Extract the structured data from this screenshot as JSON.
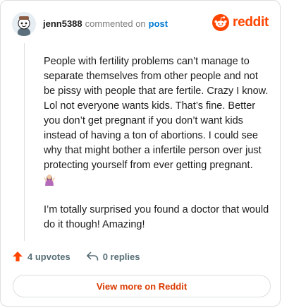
{
  "header": {
    "username": "jenn5388",
    "verb": "commented on",
    "post_link": "post"
  },
  "brand": {
    "name": "reddit",
    "icon": "reddit-logo-icon",
    "color": "#ff4500"
  },
  "comment": {
    "paragraphs": [
      "People with fertility problems can’t manage to separate themselves from other people and not be pissy with people that are fertile. Crazy I know. Lol not everyone wants kids. That’s fine. Better you don’t get pregnant if you don’t want kids instead of having a ton of abortions. I could see why that might bother a infertile person over just protecting yourself from ever getting pregnant.",
      "I’m totally surprised you found a doctor that would do it though! Amazing!"
    ],
    "emoji": "woman-shrugging-emoji"
  },
  "actions": {
    "upvotes": "4 upvotes",
    "replies": "0 replies",
    "upvote_color": "#ff4500"
  },
  "footer": {
    "view_more": "View more on Reddit",
    "color": "#d93a00"
  }
}
